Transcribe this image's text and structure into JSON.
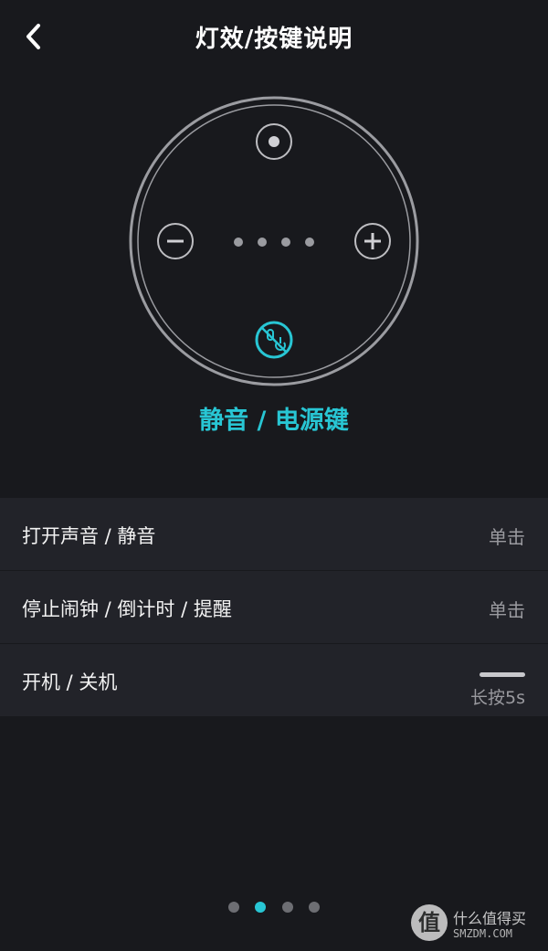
{
  "header": {
    "title": "灯效/按键说明",
    "back_icon": "chevron-left-icon"
  },
  "device": {
    "buttons": [
      "action-button",
      "volume-down-button",
      "volume-up-button",
      "mute-power-button"
    ],
    "led_count": 4,
    "highlighted_button_label": "静音 / 电源键",
    "accent_color": "#28c6d4"
  },
  "functions": [
    {
      "label": "打开声音 / 静音",
      "action": "单击"
    },
    {
      "label": "停止闹钟 / 倒计时 / 提醒",
      "action": "单击"
    },
    {
      "label": "开机 / 关机",
      "action": "长按5s"
    }
  ],
  "pager": {
    "total": 4,
    "active_index": 1
  },
  "watermark": {
    "logo_char": "值",
    "line1": "什么值得买",
    "line2": "SMZDM.COM"
  }
}
